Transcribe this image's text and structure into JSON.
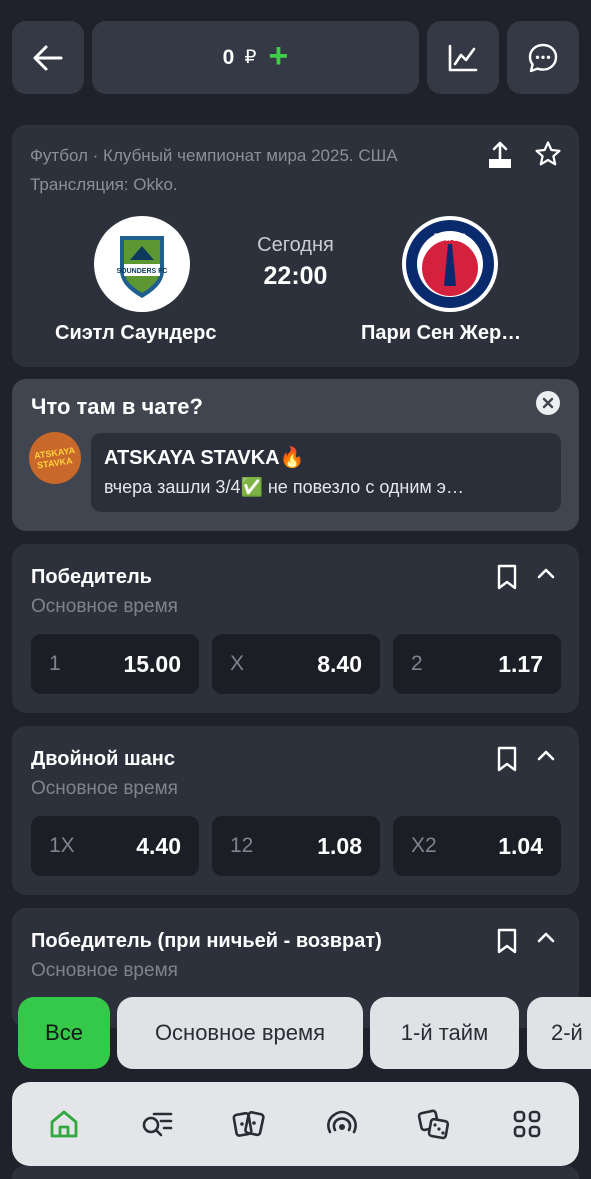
{
  "topbar": {
    "balance_value": "0",
    "balance_currency": "₽",
    "add_symbol": "+"
  },
  "match": {
    "league": "Футбол · Клубный чемпионат мира 2025. США",
    "stream": "Трансляция: Okko.",
    "day": "Сегодня",
    "time": "22:00",
    "team1": "Сиэтл Саундерс",
    "team2": "Пари Сен Жер…",
    "team1_logo_text": "SOUNDERS FC",
    "team2_logo_text": "PARIS"
  },
  "chat": {
    "title": "Что там в чате?",
    "user": "ATSKAYA STAVKA🔥",
    "message": "вчера зашли 3/4✅  не повезло с одним э…",
    "avatar_line1": "ATSKAYA",
    "avatar_line2": "STAVKA"
  },
  "markets": [
    {
      "title": "Победитель",
      "subtitle": "Основное время",
      "odds": [
        {
          "label": "1",
          "value": "15.00"
        },
        {
          "label": "X",
          "value": "8.40"
        },
        {
          "label": "2",
          "value": "1.17"
        }
      ]
    },
    {
      "title": "Двойной шанс",
      "subtitle": "Основное время",
      "odds": [
        {
          "label": "1X",
          "value": "4.40"
        },
        {
          "label": "12",
          "value": "1.08"
        },
        {
          "label": "X2",
          "value": "1.04"
        }
      ]
    },
    {
      "title": "Победитель (при ничьей - возврат)",
      "subtitle": "Основное время"
    }
  ],
  "filters": [
    "Все",
    "Основное время",
    "1-й тайм",
    "2-й"
  ],
  "colors": {
    "background": "#1f222a",
    "card": "#2d313b",
    "accent_green": "#35c94a",
    "odd_cell": "#1b1e25"
  },
  "icons": {
    "back": "arrow-left-icon",
    "chart": "chart-icon",
    "chat": "chat-bubble-icon",
    "share": "share-icon",
    "star": "star-icon",
    "close": "close-icon",
    "bookmark": "bookmark-icon",
    "collapse": "chevron-up-icon",
    "nav": [
      "home-icon",
      "search-list-icon",
      "cards-icon",
      "live-broadcast-icon",
      "dice-icon",
      "grid-menu-icon"
    ]
  }
}
